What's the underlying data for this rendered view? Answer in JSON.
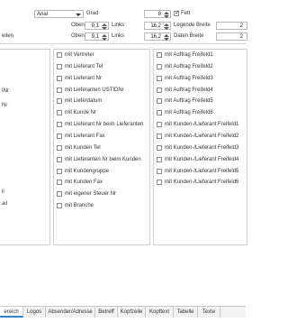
{
  "font": {
    "family": "Arial",
    "size_label": "Grad",
    "size_value": "8",
    "bold_label": "Fett",
    "bold_checked": true
  },
  "margins": {
    "left_fragment_1": "eiten",
    "row1": {
      "label": "Oben",
      "value": "9,1",
      "links_label": "Links",
      "links_value": "16,2",
      "breite_label": "Legende Breite",
      "breite_value": "2"
    },
    "row2": {
      "label": "Oben",
      "value": "9,1",
      "links_label": "Links",
      "links_value": "16,2",
      "breite_label": "Daten Breite",
      "breite_value": "2"
    }
  },
  "left_fragments": [
    "INr",
    "Nr",
    "il",
    "ail"
  ],
  "column1": [
    {
      "label": "mit Vertreter",
      "checked": false
    },
    {
      "label": "mit Lieferant Tel",
      "checked": false
    },
    {
      "label": "mit Lieferant Nr",
      "checked": false
    },
    {
      "label": "mit Lieferanten USTIDNr",
      "checked": false
    },
    {
      "label": "mit Lieferdatum",
      "checked": false
    },
    {
      "label": "mit Kunde Nr",
      "checked": false
    },
    {
      "label": "mit Lieferant Nr beim Lieferanten",
      "checked": false
    },
    {
      "label": "mit Lieferant Fax",
      "checked": false
    },
    {
      "label": "mit Kunden Tel",
      "checked": false
    },
    {
      "label": "mit Lieferanten Nr beim Kunden",
      "checked": false
    },
    {
      "label": "mit Kundengruppe",
      "checked": false
    },
    {
      "label": "mit Kunden Fax",
      "checked": false
    },
    {
      "label": "mit eigener Steuer Nr",
      "checked": false
    },
    {
      "label": "mit Branche",
      "checked": false
    }
  ],
  "column2": [
    {
      "label": "mit Auftrag Freifeld1",
      "checked": false
    },
    {
      "label": "mit Auftrag Freifeld2",
      "checked": false
    },
    {
      "label": "mit Auftrag Freifeld3",
      "checked": false
    },
    {
      "label": "mit Auftrag Freifeld4",
      "checked": false
    },
    {
      "label": "mit Auftrag Freifeld5",
      "checked": false
    },
    {
      "label": "mit Auftrag Freifeld6",
      "checked": false
    },
    {
      "label": "mit Kunden-/Lieferant Freifeld1",
      "checked": false
    },
    {
      "label": "mit Kunden-/Lieferant Freifeld2",
      "checked": false
    },
    {
      "label": "mit Kunden-/Lieferant Freifeld3",
      "checked": false
    },
    {
      "label": "mit Kunden-/Lieferant Freifeld4",
      "checked": false
    },
    {
      "label": "mit Kunden-/Lieferant Freifeld5",
      "checked": false
    },
    {
      "label": "mit Kunden-/Lieferant Freifeld6",
      "checked": false
    }
  ],
  "tabs": [
    {
      "label": "ereich",
      "active": true
    },
    {
      "label": "Logos",
      "active": false
    },
    {
      "label": "Absender/Adresse",
      "active": false
    },
    {
      "label": "Betreff",
      "active": false
    },
    {
      "label": "Kopfzeile",
      "active": false
    },
    {
      "label": "Kopftext",
      "active": false
    },
    {
      "label": "Tabelle",
      "active": false
    },
    {
      "label": "Texte",
      "active": false
    }
  ],
  "colors": {
    "accent": "#2f7fd1",
    "border": "#c8c8c8",
    "background": "#ffffff"
  }
}
